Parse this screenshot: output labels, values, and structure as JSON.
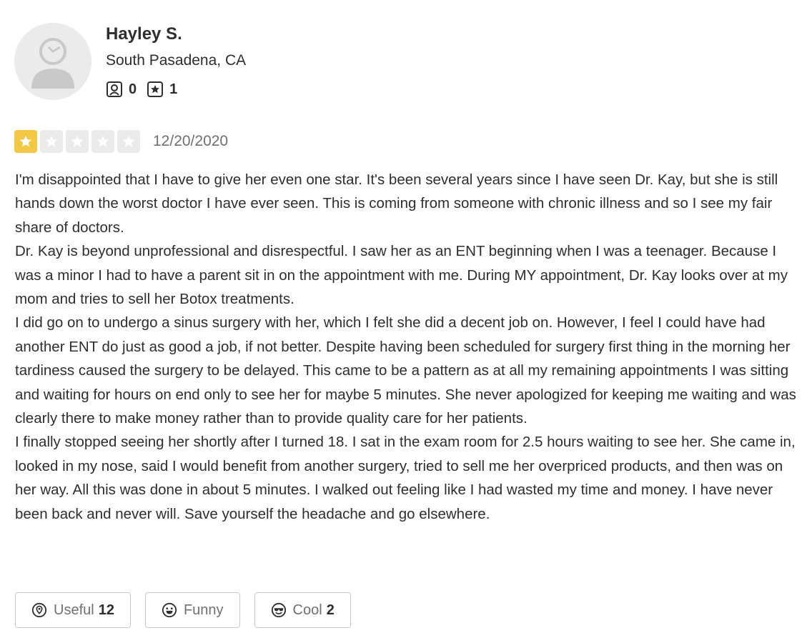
{
  "user": {
    "name": "Hayley S.",
    "location": "South Pasadena, CA",
    "friends_count": "0",
    "reviews_count": "1"
  },
  "review": {
    "rating": 1,
    "max_rating": 5,
    "date": "12/20/2020",
    "paragraphs": [
      "I'm disappointed that I have to give her even one star. It's been several years since I have seen Dr. Kay, but she is still hands down the worst doctor I have ever seen. This is coming from someone with chronic illness and so I see my fair share of doctors.",
      "Dr. Kay is beyond unprofessional and disrespectful. I saw her as an ENT beginning when I was a teenager. Because I was a minor I had to have a parent sit in on the appointment with me. During MY appointment, Dr. Kay looks over at my mom and tries to sell her Botox treatments.",
      "I did go on to undergo a sinus surgery with her, which I felt she did a decent job on. However, I feel I could have had another ENT do just as good a job, if not better. Despite having been scheduled for surgery first thing in the morning her tardiness caused the surgery to be delayed. This came to be a pattern as at all my remaining appointments I was sitting and waiting for hours on end only to see her for maybe 5 minutes. She never apologized for keeping me waiting and was clearly there to make money rather than to provide quality care for her patients.",
      "I finally stopped seeing her shortly after I turned 18. I sat in the exam room for 2.5 hours waiting to see her. She came in, looked in my nose, said I would benefit from another surgery, tried to sell me her overpriced products, and then was on her way. All this was done in about 5 minutes. I walked out feeling like I had wasted my time and money. I have never been back and never will. Save yourself the headache and go elsewhere."
    ]
  },
  "reactions": {
    "useful_label": "Useful",
    "useful_count": "12",
    "funny_label": "Funny",
    "cool_label": "Cool",
    "cool_count": "2"
  },
  "colors": {
    "star_filled": "#f2c844",
    "star_empty": "#ebebeb",
    "text": "#2d2e2f",
    "muted": "#6e7072"
  },
  "icons": [
    "avatar-placeholder-icon",
    "friends-icon",
    "review-count-icon",
    "star-icon",
    "useful-icon",
    "funny-icon",
    "cool-icon"
  ]
}
